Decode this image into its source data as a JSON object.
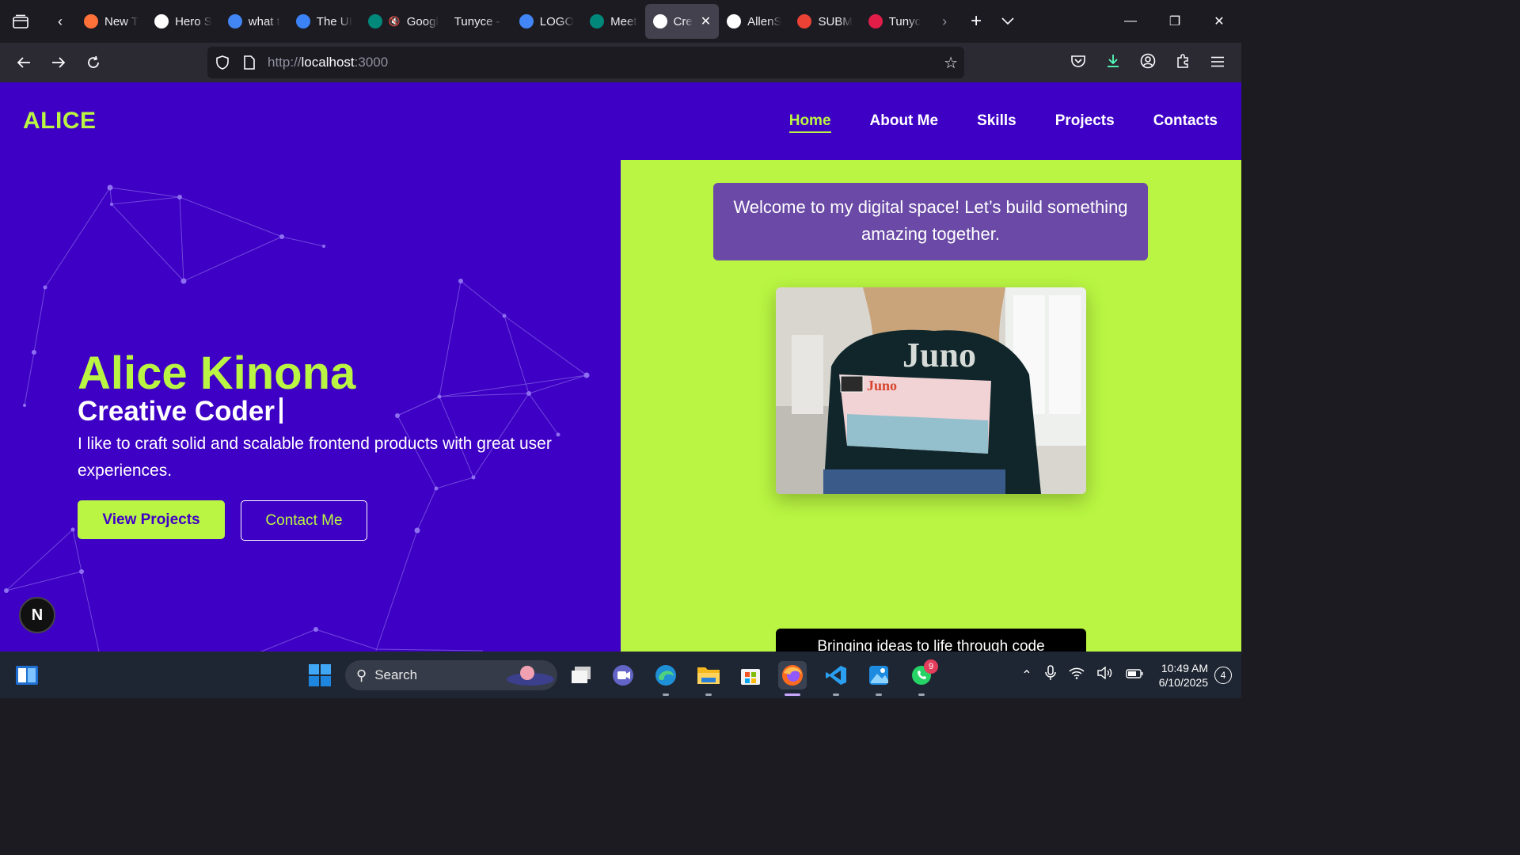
{
  "browser": {
    "tabs": [
      {
        "label": "New T",
        "icon": "firefox-icon",
        "color": "#ff7139"
      },
      {
        "label": "Hero S",
        "icon": "openai-icon",
        "color": "#ffffff"
      },
      {
        "label": "what t",
        "icon": "google-icon",
        "color": "#4285f4"
      },
      {
        "label": "The UI",
        "icon": "app-icon",
        "color": "#3b82f6"
      },
      {
        "label": "Googl",
        "icon": "meet-icon",
        "color": "#00897b",
        "muted": true
      },
      {
        "label": "Tunyce - R",
        "icon": "none",
        "color": "#1c1b22"
      },
      {
        "label": "LOGO",
        "icon": "google-icon",
        "color": "#4285f4"
      },
      {
        "label": "Meet",
        "icon": "meet-icon",
        "color": "#00897b"
      },
      {
        "label": "Cre",
        "icon": "vercel-icon",
        "color": "#ffffff",
        "active": true
      },
      {
        "label": "AllenS",
        "icon": "github-icon",
        "color": "#ffffff"
      },
      {
        "label": "SUBM",
        "icon": "gmail-icon",
        "color": "#ea4335"
      },
      {
        "label": "Tunyc",
        "icon": "app-icon",
        "color": "#e11d48"
      }
    ],
    "url_host": "localhost",
    "url_prefix": "http://",
    "url_port": ":3000"
  },
  "site": {
    "logo": "ALICE",
    "menu": [
      "Home",
      "About Me",
      "Skills",
      "Projects",
      "Contacts"
    ],
    "active_menu": "Home",
    "hero": {
      "name": "Alice Kinona",
      "role": "Creative Coder",
      "description": "I like to craft solid and scalable frontend products with great user experiences.",
      "primary_button": "View Projects",
      "secondary_button": "Contact Me"
    },
    "welcome": "Welcome to my digital space! Let’s build something amazing together.",
    "photo_brand": "Juno",
    "tagline": "Bringing ideas to life through code",
    "next_badge": "N",
    "colors": {
      "primary": "#3f00c6",
      "accent": "#b9f542",
      "card": "#6a4aa6"
    }
  },
  "taskbar": {
    "search_placeholder": "Search",
    "whatsapp_badge": "9",
    "time": "10:49 AM",
    "date": "6/10/2025",
    "notifications": "4"
  }
}
